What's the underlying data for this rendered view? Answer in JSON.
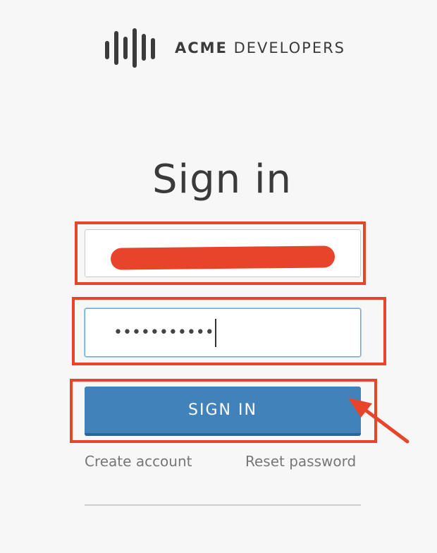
{
  "brand": {
    "name_strong": "ACME",
    "name_rest": " DEVELOPERS",
    "logo_icon": "sound-bars-icon"
  },
  "heading": "Sign in",
  "form": {
    "username": {
      "value": "",
      "redacted": true
    },
    "password": {
      "masked_value": "•••••••••••"
    },
    "submit_label": "SIGN IN"
  },
  "links": {
    "create_account": "Create account",
    "reset_password": "Reset password"
  },
  "colors": {
    "background": "#f7f7f7",
    "button": "#4182ba",
    "annotation": "#e8442a"
  }
}
